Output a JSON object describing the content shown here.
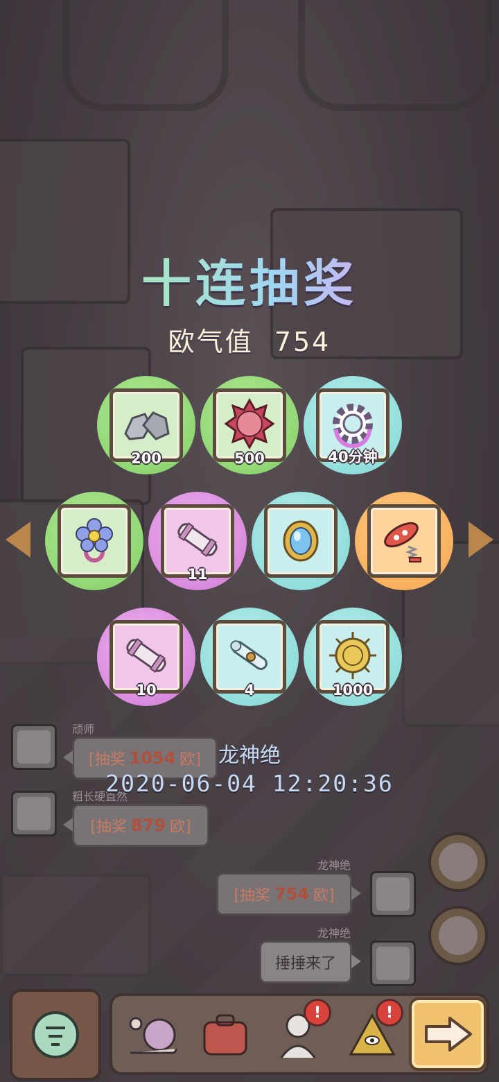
{
  "title": "十连抽奖",
  "luck_label": "欧气值",
  "luck_value": "754",
  "rewards": [
    {
      "icon": "stone-icon",
      "qty": "200",
      "color": "green"
    },
    {
      "icon": "spiked-shell-icon",
      "qty": "500",
      "color": "green"
    },
    {
      "icon": "gear-icon",
      "qty": "40分钟",
      "color": "cyan"
    },
    {
      "icon": "flower-ring-icon",
      "qty": "",
      "color": "green"
    },
    {
      "icon": "blueprint-scroll-icon",
      "qty": "11",
      "color": "purple"
    },
    {
      "icon": "gem-amulet-icon",
      "qty": "",
      "color": "cyan"
    },
    {
      "icon": "rocket-spring-icon",
      "qty": "",
      "color": "orange"
    },
    {
      "icon": "blueprint-scroll-icon",
      "qty": "10",
      "color": "purple"
    },
    {
      "icon": "paper-scroll-icon",
      "qty": "4",
      "color": "cyan"
    },
    {
      "icon": "golden-medal-icon",
      "qty": "1000",
      "color": "cyan"
    }
  ],
  "chat": [
    {
      "name": "顽师",
      "prefix": "[抽奖",
      "num": "1054",
      "suffix": "欧]"
    },
    {
      "name": "粗长硬直然",
      "prefix": "[抽奖",
      "num": "879",
      "suffix": "欧]"
    },
    {
      "name": "龙神绝",
      "prefix": "[抽奖",
      "num": "754",
      "suffix": "欧]"
    },
    {
      "name": "龙神绝",
      "text": "捶捶来了"
    }
  ],
  "winner": {
    "name": "龙神绝",
    "time": "2020-06-04 12:20:36"
  },
  "bottom_bar": {
    "badge": "!"
  },
  "colors": {
    "green": "#7fcf63",
    "cyan": "#7fd6d3",
    "purple": "#cf7ad4",
    "orange": "#f5a44b"
  }
}
